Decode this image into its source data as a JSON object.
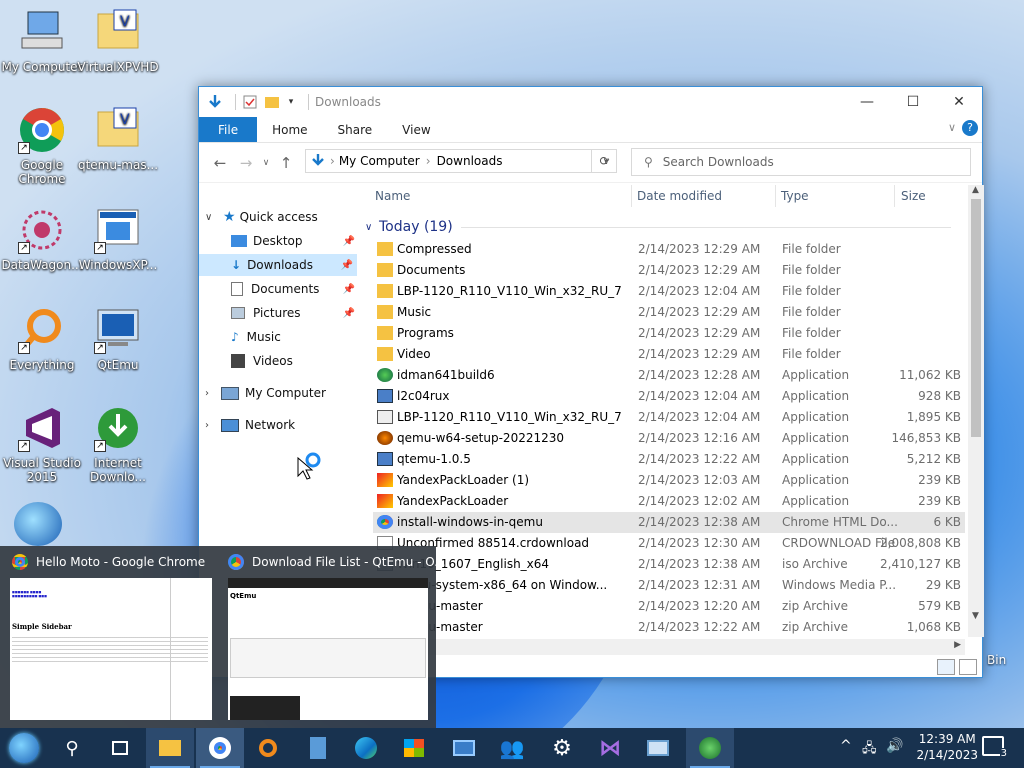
{
  "desktop": {
    "icons": [
      {
        "label": "My Computer",
        "icon": "computer-icon"
      },
      {
        "label": "VirtualXPVHD",
        "icon": "folder-icon"
      },
      {
        "label": "Google Chrome",
        "icon": "chrome-icon"
      },
      {
        "label": "qtemu-mas...",
        "icon": "folder-icon"
      },
      {
        "label": "DataWagon...",
        "icon": "datawagon-icon"
      },
      {
        "label": "WindowsXP...",
        "icon": "window-icon"
      },
      {
        "label": "Everything",
        "icon": "search-icon"
      },
      {
        "label": "QtEmu",
        "icon": "qtemu-icon"
      },
      {
        "label": "Visual Studio 2015",
        "icon": "visual-studio-icon"
      },
      {
        "label": "Internet Downlo...",
        "icon": "idm-icon"
      }
    ],
    "recycle_label": "Bin"
  },
  "explorer": {
    "title": "Downloads",
    "ribbon_tabs": [
      "File",
      "Home",
      "Share",
      "View"
    ],
    "address": {
      "root": "My Computer",
      "folder": "Downloads"
    },
    "search_placeholder": "Search Downloads",
    "nav": {
      "quick_access": "Quick access",
      "items": [
        "Desktop",
        "Downloads",
        "Documents",
        "Pictures",
        "Music",
        "Videos"
      ],
      "my_computer": "My Computer",
      "network": "Network"
    },
    "columns": {
      "name": "Name",
      "date": "Date modified",
      "type": "Type",
      "size": "Size"
    },
    "group": "Today (19)",
    "files": [
      {
        "name": "Compressed",
        "date": "2/14/2023 12:29 AM",
        "type": "File folder",
        "size": "",
        "icon": "folder-icon"
      },
      {
        "name": "Documents",
        "date": "2/14/2023 12:29 AM",
        "type": "File folder",
        "size": "",
        "icon": "folder-icon"
      },
      {
        "name": "LBP-1120_R110_V110_Win_x32_RU_7",
        "date": "2/14/2023 12:04 AM",
        "type": "File folder",
        "size": "",
        "icon": "folder-icon"
      },
      {
        "name": "Music",
        "date": "2/14/2023 12:29 AM",
        "type": "File folder",
        "size": "",
        "icon": "folder-icon"
      },
      {
        "name": "Programs",
        "date": "2/14/2023 12:29 AM",
        "type": "File folder",
        "size": "",
        "icon": "folder-icon"
      },
      {
        "name": "Video",
        "date": "2/14/2023 12:29 AM",
        "type": "File folder",
        "size": "",
        "icon": "folder-icon"
      },
      {
        "name": "idman641build6",
        "date": "2/14/2023 12:28 AM",
        "type": "Application",
        "size": "11,062 KB",
        "icon": "idm-icon"
      },
      {
        "name": "l2c04rux",
        "date": "2/14/2023 12:04 AM",
        "type": "Application",
        "size": "928 KB",
        "icon": "app-icon"
      },
      {
        "name": "LBP-1120_R110_V110_Win_x32_RU_7",
        "date": "2/14/2023 12:04 AM",
        "type": "Application",
        "size": "1,895 KB",
        "icon": "installer-icon"
      },
      {
        "name": "qemu-w64-setup-20221230",
        "date": "2/14/2023 12:16 AM",
        "type": "Application",
        "size": "146,853 KB",
        "icon": "qemu-icon"
      },
      {
        "name": "qtemu-1.0.5",
        "date": "2/14/2023 12:22 AM",
        "type": "Application",
        "size": "5,212 KB",
        "icon": "app-icon"
      },
      {
        "name": "YandexPackLoader (1)",
        "date": "2/14/2023 12:03 AM",
        "type": "Application",
        "size": "239 KB",
        "icon": "yandex-icon"
      },
      {
        "name": "YandexPackLoader",
        "date": "2/14/2023 12:02 AM",
        "type": "Application",
        "size": "239 KB",
        "icon": "yandex-icon"
      },
      {
        "name": "install-windows-in-qemu",
        "date": "2/14/2023 12:38 AM",
        "type": "Chrome HTML Do...",
        "size": "6 KB",
        "icon": "chrome-icon"
      },
      {
        "name": "Unconfirmed 88514.crdownload",
        "date": "2/14/2023 12:30 AM",
        "type": "CRDOWNLOAD File",
        "size": "2,008,808 KB",
        "icon": "file-icon"
      },
      {
        "name": "Win10_1607_English_x64",
        "date": "2/14/2023 12:38 AM",
        "type": "iso Archive",
        "size": "2,410,127 KB",
        "icon": "archive-icon"
      },
      {
        "name": "qemu-system-x86_64 on Window...",
        "date": "2/14/2023 12:31 AM",
        "type": "Windows Media P...",
        "size": "29 KB",
        "icon": "media-icon"
      },
      {
        "name": "qtemu-master",
        "date": "2/14/2023 12:20 AM",
        "type": "zip Archive",
        "size": "579 KB",
        "icon": "archive-icon"
      },
      {
        "name": "qtemu-master",
        "date": "2/14/2023 12:22 AM",
        "type": "zip Archive",
        "size": "1,068 KB",
        "icon": "archive-icon"
      }
    ]
  },
  "thumbnails": [
    {
      "title": "Hello Moto - Google Chrome",
      "preview_heading": "Simple Sidebar"
    },
    {
      "title": "Download File List - QtEmu - O...",
      "preview_heading": "QtEmu"
    }
  ],
  "taskbar": {
    "time": "12:39 AM",
    "date": "2/14/2023",
    "notification_count": "3"
  }
}
